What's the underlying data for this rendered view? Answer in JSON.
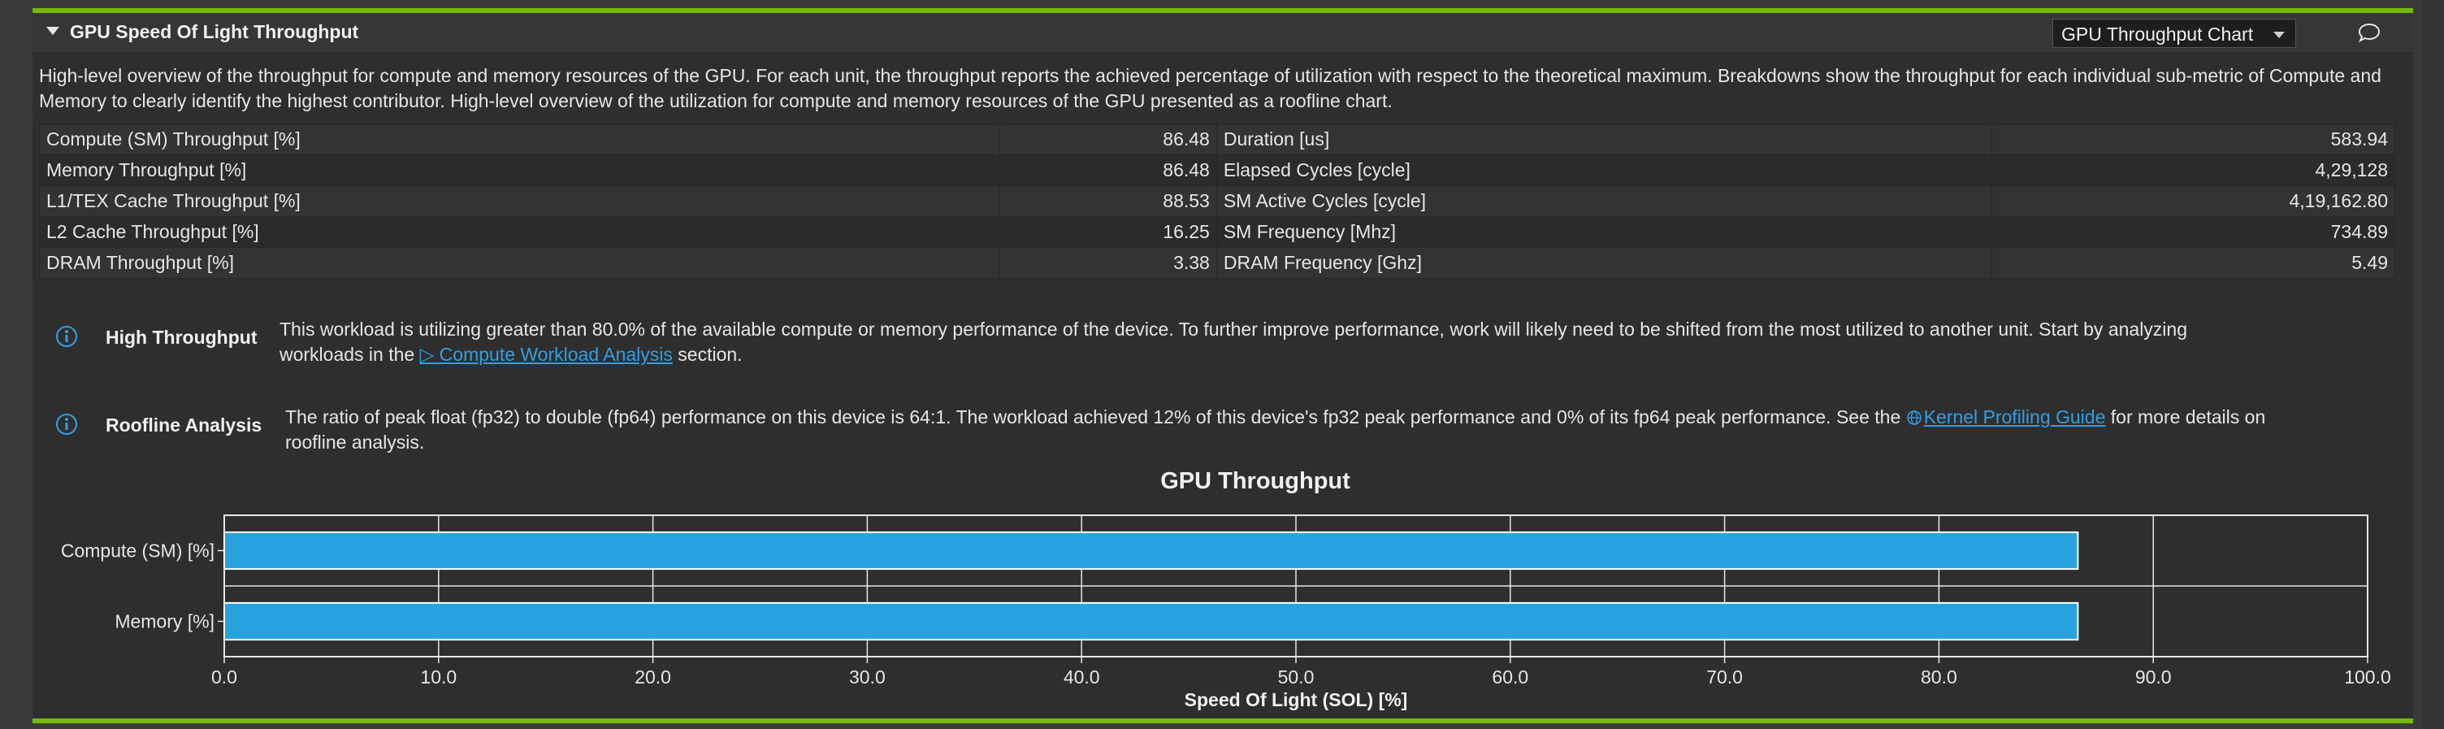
{
  "section": {
    "title": "GPU Speed Of Light Throughput",
    "view_select": "GPU Throughput Chart",
    "description": "High-level overview of the throughput for compute and memory resources of the GPU. For each unit, the throughput reports the achieved percentage of utilization with respect to the theoretical maximum. Breakdowns show the throughput for each individual sub-metric of Compute and Memory to clearly identify the highest contributor. High-level overview of the utilization for compute and memory resources of the GPU presented as a roofline chart."
  },
  "metrics": [
    {
      "name": "Compute (SM) Throughput [%]",
      "value": "86.48",
      "name2": "Duration [us]",
      "value2": "583.94"
    },
    {
      "name": "Memory Throughput [%]",
      "value": "86.48",
      "name2": "Elapsed Cycles [cycle]",
      "value2": "4,29,128"
    },
    {
      "name": "L1/TEX Cache Throughput [%]",
      "value": "88.53",
      "name2": "SM Active Cycles [cycle]",
      "value2": "4,19,162.80"
    },
    {
      "name": "L2 Cache Throughput [%]",
      "value": "16.25",
      "name2": "SM Frequency [Mhz]",
      "value2": "734.89"
    },
    {
      "name": "DRAM Throughput [%]",
      "value": "3.38",
      "name2": "DRAM Frequency [Ghz]",
      "value2": "5.49"
    }
  ],
  "notes": {
    "high_throughput": {
      "label": "High Throughput",
      "line1": "This workload is utilizing greater than 80.0% of the available compute or memory performance of the device. To further improve performance, work will likely need to be shifted from the most utilized to another unit. Start by analyzing",
      "line2_before": "workloads in the ",
      "link": "Compute Workload Analysis",
      "line2_after": " section."
    },
    "roofline": {
      "label": "Roofline Analysis",
      "line1_before": "The ratio of peak float (fp32) to double (fp64) performance on this device is 64:1. The workload achieved 12% of this device's fp32 peak performance and 0% of its fp64 peak performance. See the ",
      "link": "Kernel Profiling Guide",
      "line1_after": " for more details on",
      "line2": "roofline analysis."
    }
  },
  "icons": {
    "expand": "caret-down-icon",
    "dropdown": "chevron-down-icon",
    "comment": "comment-icon",
    "info": "info-icon",
    "link_arrow": "play-arrow-icon",
    "globe": "globe-icon"
  },
  "colors": {
    "accent": "#76b900",
    "bar": "#29a3e0",
    "link": "#2f9fe6",
    "info": "#3b9ddd"
  },
  "chart_data": {
    "type": "bar",
    "orientation": "horizontal",
    "title": "GPU Throughput",
    "xlabel": "Speed Of Light (SOL) [%]",
    "ylabel": "",
    "categories": [
      "Compute (SM) [%]",
      "Memory [%]"
    ],
    "values": [
      86.48,
      86.48
    ],
    "xlim": [
      0,
      100
    ],
    "xticks": [
      "0.0",
      "10.0",
      "20.0",
      "30.0",
      "40.0",
      "50.0",
      "60.0",
      "70.0",
      "80.0",
      "90.0",
      "100.0"
    ],
    "grid": true,
    "legend": "none"
  }
}
